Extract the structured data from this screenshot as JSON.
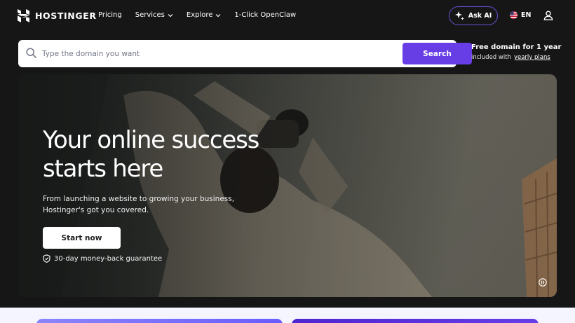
{
  "brand": {
    "name": "HOSTINGER"
  },
  "nav": {
    "items": [
      {
        "label": "Pricing",
        "has_dropdown": false
      },
      {
        "label": "Services",
        "has_dropdown": true
      },
      {
        "label": "Explore",
        "has_dropdown": true
      },
      {
        "label": "1-Click OpenClaw",
        "has_dropdown": false
      }
    ]
  },
  "header": {
    "ask_ai_label": "Ask AI",
    "language": "EN",
    "icons": {
      "ask_ai": "sparkle-icon",
      "language": "us-flag-icon",
      "account": "user-icon"
    }
  },
  "search": {
    "placeholder": "Type the domain you want",
    "button_label": "Search",
    "icon": "search-icon"
  },
  "promo": {
    "title": "Free domain for 1 year",
    "subtitle": "included with",
    "link_label": "yearly plans"
  },
  "hero": {
    "title": "Your online success starts here",
    "subtitle": "From launching a website to growing your business, Hostinger's got you covered.",
    "cta_label": "Start now",
    "guarantee": "30-day money-back guarantee",
    "icons": {
      "guarantee": "shield-check-icon",
      "video_control": "pause-icon"
    }
  },
  "colors": {
    "accent": "#673de6",
    "background": "#161616",
    "ask_ai_border": "#6b4fd8",
    "bottom_section": "#f4f5ff"
  }
}
